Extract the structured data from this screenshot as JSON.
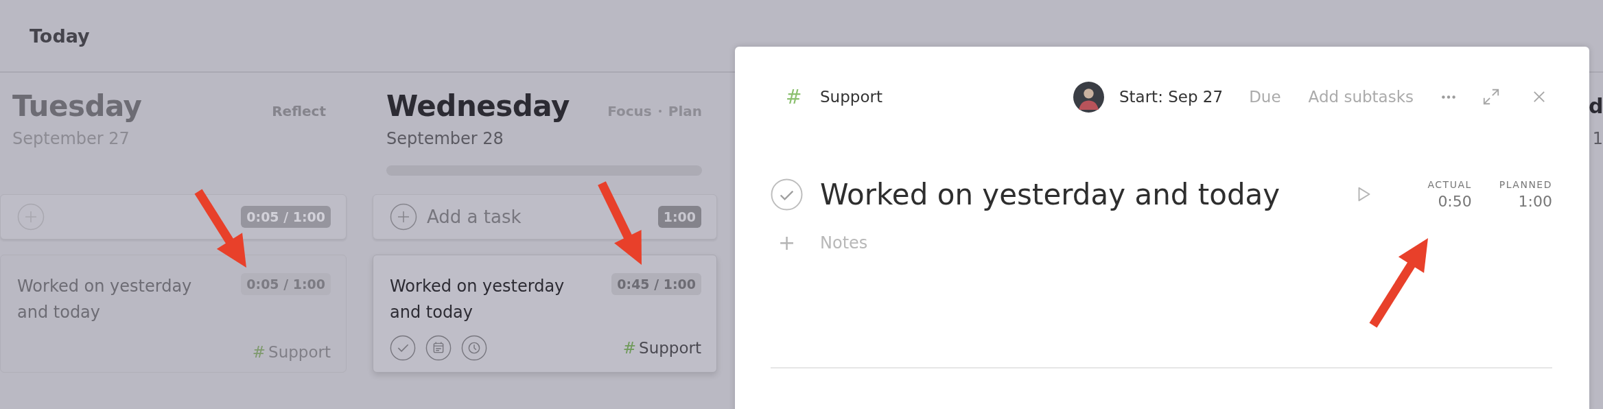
{
  "header": {
    "title": "Today"
  },
  "days": [
    {
      "name": "Tuesday",
      "date": "September 27",
      "past": true,
      "actions": [
        "Reflect"
      ],
      "add_task": {
        "time": "0:05 / 1:00"
      },
      "tasks": [
        {
          "title": "Worked on yesterday and today",
          "time": "0:05 / 1:00",
          "hovered": false,
          "tag": {
            "symbol": "#",
            "name": "Support",
            "color": "#7f9a6e"
          }
        }
      ]
    },
    {
      "name": "Wednesday",
      "date": "September 28",
      "past": false,
      "actions": [
        "Focus",
        "Plan"
      ],
      "progress": {
        "level": 0
      },
      "add_task": {
        "label": "Add a task",
        "time": "1:00"
      },
      "tasks": [
        {
          "title": "Worked on yesterday and today",
          "time": "0:45 / 1:00",
          "hovered": true,
          "tag": {
            "symbol": "#",
            "name": "Support",
            "color": "#6f9a5a"
          }
        }
      ]
    }
  ],
  "next_day": {
    "name": "d",
    "date": "1"
  },
  "panel": {
    "tag": {
      "symbol": "#",
      "name": "Support",
      "color": "#8cc070"
    },
    "start": "Start: Sep 27",
    "due": "Due",
    "add_subtasks": "Add subtasks",
    "title": "Worked on yesterday and today",
    "completed": false,
    "timer": {
      "actual_label": "ACTUAL",
      "actual": "0:50",
      "planned_label": "PLANNED",
      "planned": "1:00"
    },
    "notes": {
      "add_symbol": "+",
      "placeholder": "Notes"
    }
  }
}
